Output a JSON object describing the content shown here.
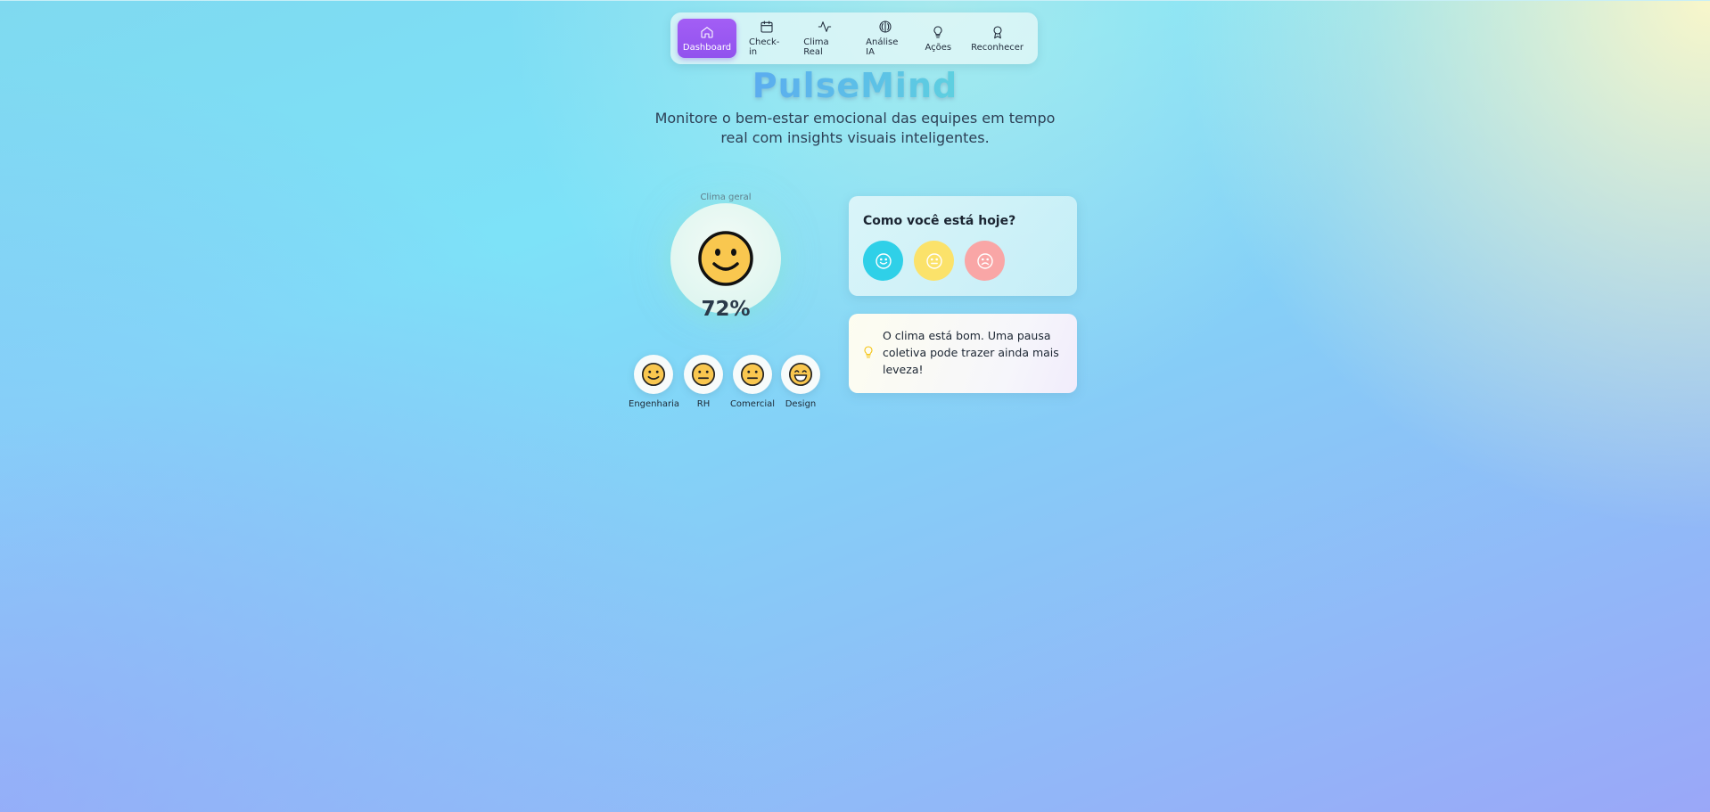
{
  "nav": {
    "items": [
      {
        "label": "Dashboard",
        "icon": "home-icon",
        "active": true
      },
      {
        "label": "Check-in",
        "icon": "calendar-icon",
        "active": false
      },
      {
        "label": "Clima Real",
        "icon": "activity-icon",
        "active": false
      },
      {
        "label": "Análise IA",
        "icon": "brain-icon",
        "active": false
      },
      {
        "label": "Ações",
        "icon": "lightbulb-icon",
        "active": false
      },
      {
        "label": "Reconhecer",
        "icon": "award-icon",
        "active": false
      }
    ]
  },
  "header": {
    "brand": "PulseMind",
    "subtitle": "Monitore o bem-estar emocional das equipes em tempo real com insights visuais inteligentes."
  },
  "climate": {
    "label": "Clima geral",
    "percent": "72%",
    "face": "smile"
  },
  "teams": [
    {
      "name": "Engenharia",
      "face": "smile"
    },
    {
      "name": "RH",
      "face": "neutral"
    },
    {
      "name": "Comercial",
      "face": "neutral"
    },
    {
      "name": "Design",
      "face": "grin"
    }
  ],
  "mood_card": {
    "title": "Como você está hoje?",
    "options": [
      "happy",
      "neutral",
      "sad"
    ],
    "colors": {
      "happy": "#2fd0e8",
      "neutral": "#fbe26a",
      "sad": "#f9a6a6"
    }
  },
  "tip": {
    "icon": "lightbulb-icon",
    "text": "O clima está bom. Uma pausa coletiva pode trazer ainda mais leveza!"
  },
  "colors": {
    "accent": "#9b5cf4",
    "face_fill": "#f9c74f"
  }
}
